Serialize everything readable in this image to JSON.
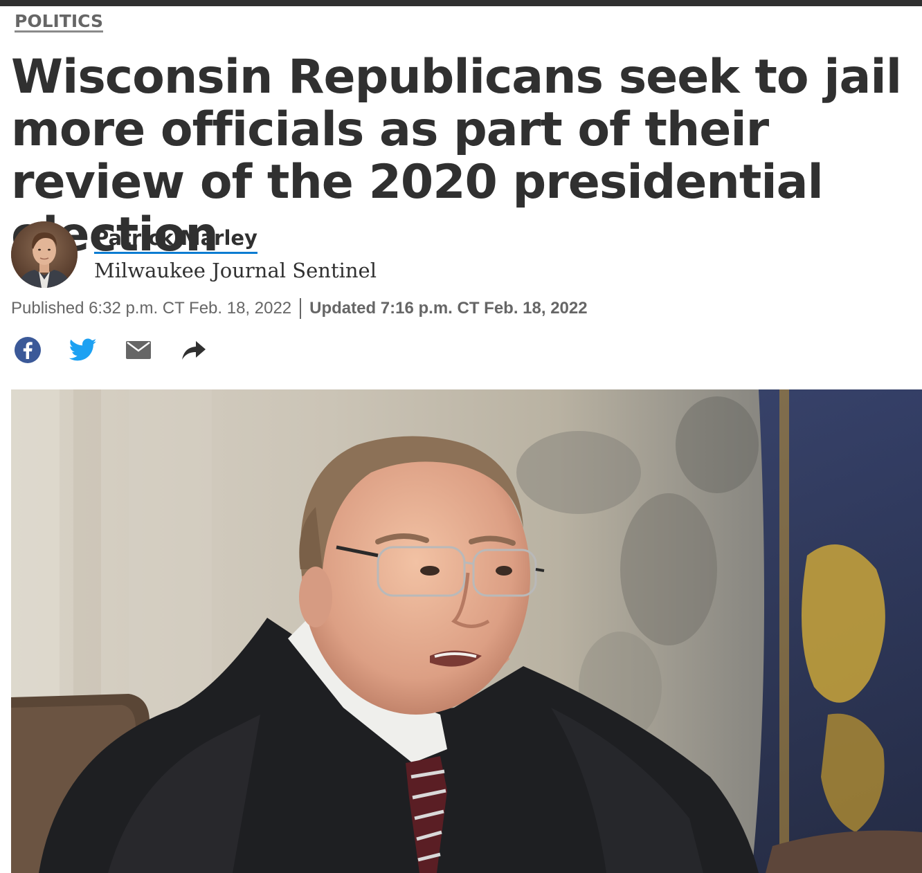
{
  "section": {
    "label": "POLITICS"
  },
  "article": {
    "headline": "Wisconsin Republicans seek to jail more officials as part of their review of the 2020 presidential election"
  },
  "byline": {
    "author_name": "Patrick Marley",
    "organization": "Milwaukee Journal Sentinel"
  },
  "dates": {
    "published": "Published 6:32 p.m. CT Feb. 18, 2022",
    "updated": "Updated 7:16 p.m. CT Feb. 18, 2022"
  },
  "share": {
    "icons": [
      "facebook-icon",
      "twitter-icon",
      "email-icon",
      "share-arrow-icon"
    ],
    "colors": {
      "facebook": "#3b5998",
      "twitter": "#1da1f2",
      "email": "#666666",
      "share": "#303030"
    }
  },
  "theme": {
    "text_dark": "#303030",
    "text_muted": "#666666",
    "link_underline": "#0a7cd1",
    "top_bar": "#303030"
  }
}
